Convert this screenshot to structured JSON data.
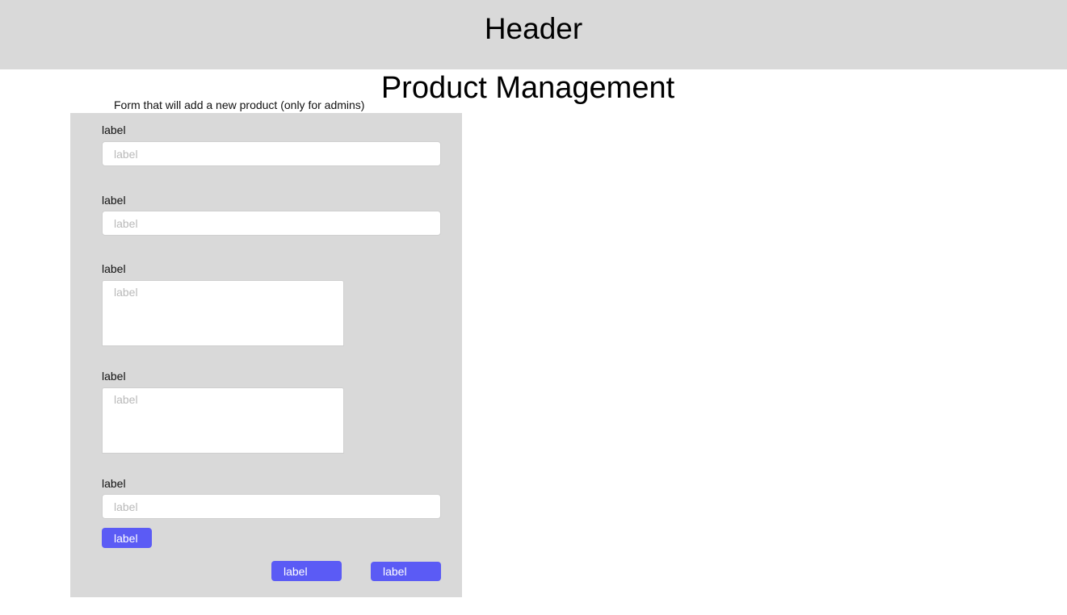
{
  "header": {
    "title": "Header"
  },
  "page": {
    "title": "Product Management",
    "form_caption": "Form that will add a new product (only for admins)"
  },
  "form": {
    "fields": [
      {
        "label": "label",
        "placeholder": "label",
        "type": "text"
      },
      {
        "label": "label",
        "placeholder": "label",
        "type": "text"
      },
      {
        "label": "label",
        "placeholder": "label",
        "type": "textarea"
      },
      {
        "label": "label",
        "placeholder": "label",
        "type": "textarea"
      },
      {
        "label": "label",
        "placeholder": "label",
        "type": "text"
      }
    ],
    "inline_button_label": "label",
    "footer_buttons": [
      "label",
      "label"
    ]
  },
  "colors": {
    "header_bg": "#d9d9d9",
    "panel_bg": "#d9d9d9",
    "button_bg": "#5b5bf5",
    "button_text": "#ffffff",
    "placeholder": "#b9b9b9"
  }
}
